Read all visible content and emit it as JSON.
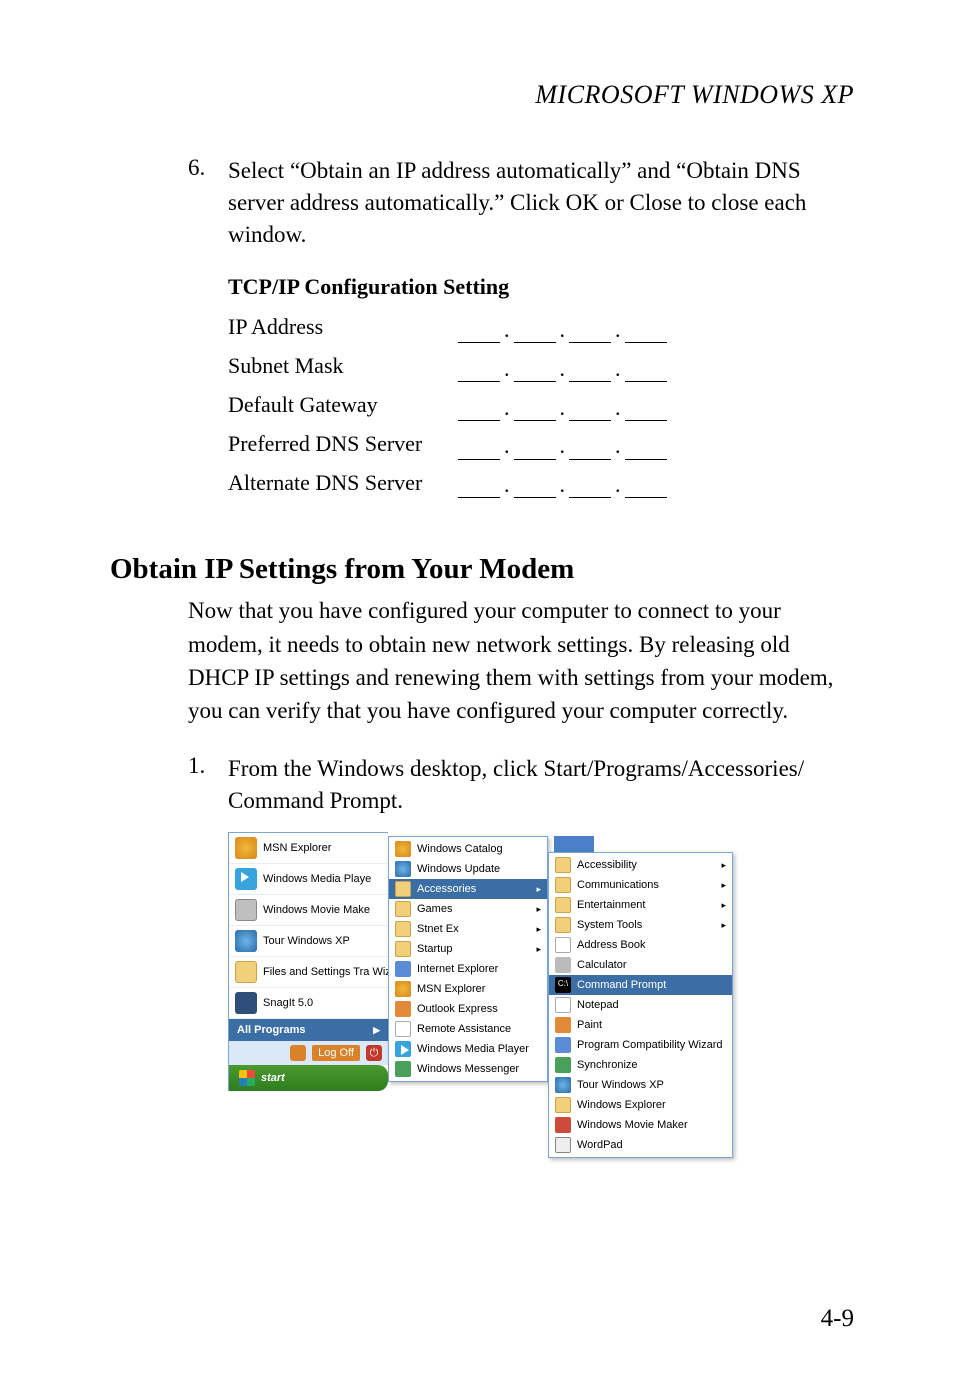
{
  "header": {
    "title": "MICROSOFT WINDOWS XP"
  },
  "step6": {
    "number": "6.",
    "text": "Select “Obtain an IP address automatically” and “Obtain DNS server address automatically.” Click OK or Close to close each window."
  },
  "tcp": {
    "heading": "TCP/IP Configuration Setting",
    "rows": [
      "IP Address",
      "Subnet Mask",
      "Default Gateway",
      "Preferred DNS Server",
      "Alternate DNS Server"
    ]
  },
  "section": {
    "heading": "Obtain IP Settings from Your Modem",
    "para": "Now that you have configured your computer to connect to your modem, it needs to obtain new network settings. By releasing old DHCP IP settings and renewing them with settings from your modem, you can verify that you have configured your computer correctly."
  },
  "step1": {
    "number": "1.",
    "text": "From the Windows desktop, click Start/Programs/Accessories/ Command Prompt."
  },
  "screenshot": {
    "left": {
      "items": [
        "MSN Explorer",
        "Windows Media Playe",
        "Windows Movie Make",
        "Tour Windows XP",
        "Files and Settings Tra Wizard",
        "SnagIt 5.0"
      ],
      "all_programs": "All Programs",
      "logoff": "Log Off",
      "start": "start"
    },
    "middle": {
      "items": [
        {
          "label": "Windows Catalog",
          "sub": false,
          "sel": false,
          "ic": "ic-msn"
        },
        {
          "label": "Windows Update",
          "sub": false,
          "sel": false,
          "ic": "ic-globe"
        },
        {
          "label": "Accessories",
          "sub": true,
          "sel": true,
          "ic": "ic-folder"
        },
        {
          "label": "Games",
          "sub": true,
          "sel": false,
          "ic": "ic-folder"
        },
        {
          "label": "Stnet Ex",
          "sub": true,
          "sel": false,
          "ic": "ic-folder"
        },
        {
          "label": "Startup",
          "sub": true,
          "sel": false,
          "ic": "ic-folder"
        },
        {
          "label": "Internet Explorer",
          "sub": false,
          "sel": false,
          "ic": "ic-blue"
        },
        {
          "label": "MSN Explorer",
          "sub": false,
          "sel": false,
          "ic": "ic-msn"
        },
        {
          "label": "Outlook Express",
          "sub": false,
          "sel": false,
          "ic": "ic-orange"
        },
        {
          "label": "Remote Assistance",
          "sub": false,
          "sel": false,
          "ic": "ic-white"
        },
        {
          "label": "Windows Media Player",
          "sub": false,
          "sel": false,
          "ic": "ic-play"
        },
        {
          "label": "Windows Messenger",
          "sub": false,
          "sel": false,
          "ic": "ic-green"
        }
      ]
    },
    "right": {
      "items": [
        {
          "label": "Accessibility",
          "sub": true,
          "sel": false,
          "ic": "ic-folder"
        },
        {
          "label": "Communications",
          "sub": true,
          "sel": false,
          "ic": "ic-folder"
        },
        {
          "label": "Entertainment",
          "sub": true,
          "sel": false,
          "ic": "ic-folder"
        },
        {
          "label": "System Tools",
          "sub": true,
          "sel": false,
          "ic": "ic-folder"
        },
        {
          "label": "Address Book",
          "sub": false,
          "sel": false,
          "ic": "ic-white"
        },
        {
          "label": "Calculator",
          "sub": false,
          "sel": false,
          "ic": "ic-grey"
        },
        {
          "label": "Command Prompt",
          "sub": false,
          "sel": true,
          "ic": "ic-prompt"
        },
        {
          "label": "Notepad",
          "sub": false,
          "sel": false,
          "ic": "ic-white"
        },
        {
          "label": "Paint",
          "sub": false,
          "sel": false,
          "ic": "ic-orange"
        },
        {
          "label": "Program Compatibility Wizard",
          "sub": false,
          "sel": false,
          "ic": "ic-blue"
        },
        {
          "label": "Synchronize",
          "sub": false,
          "sel": false,
          "ic": "ic-green"
        },
        {
          "label": "Tour Windows XP",
          "sub": false,
          "sel": false,
          "ic": "ic-globe"
        },
        {
          "label": "Windows Explorer",
          "sub": false,
          "sel": false,
          "ic": "ic-folder"
        },
        {
          "label": "Windows Movie Maker",
          "sub": false,
          "sel": false,
          "ic": "ic-red"
        },
        {
          "label": "WordPad",
          "sub": false,
          "sel": false,
          "ic": "ic-wpad"
        }
      ]
    }
  },
  "page_number": "4-9"
}
